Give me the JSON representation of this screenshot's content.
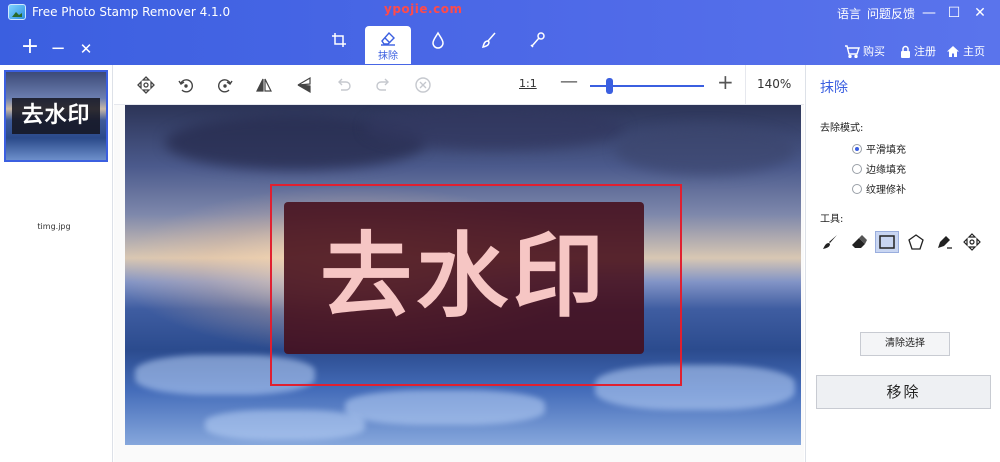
{
  "app": {
    "title": "Free Photo Stamp Remover 4.1.0",
    "watermark_url": "ypojie.com"
  },
  "top_links": {
    "language": "语言",
    "feedback": "问题反馈"
  },
  "window_controls": {
    "minimize": "—",
    "maximize": "☐",
    "close": "✕"
  },
  "file_buttons": {
    "add": "+",
    "remove": "−",
    "close": "✕"
  },
  "mode_tabs": {
    "active_label": "抹除"
  },
  "store": {
    "buy": "购买",
    "register": "注册",
    "home": "主页"
  },
  "thumbnail": {
    "watermark": "去水印",
    "filename": "timg.jpg"
  },
  "toolbar": {
    "actual_size": "1:1",
    "zoom_out": "—",
    "zoom_in": "+",
    "zoom_level": "140%",
    "zoom_fraction": 0.17
  },
  "canvas": {
    "watermark_text": "去水印"
  },
  "panel": {
    "title": "抹除",
    "mode_heading": "去除模式:",
    "modes": [
      "平滑填充",
      "边缘填充",
      "纹理修补"
    ],
    "selected_mode": 0,
    "tools_heading": "工具:",
    "selected_tool": "rectangle",
    "clear_selection": "清除选择",
    "remove": "移除"
  },
  "colors": {
    "accent": "#3b5fe0",
    "selection_border": "#e02030"
  },
  "icons": {
    "crop": "crop-icon",
    "erase": "eraser-icon",
    "drop": "drop-icon",
    "brush": "brush-icon",
    "stamp": "clone-stamp-icon"
  }
}
